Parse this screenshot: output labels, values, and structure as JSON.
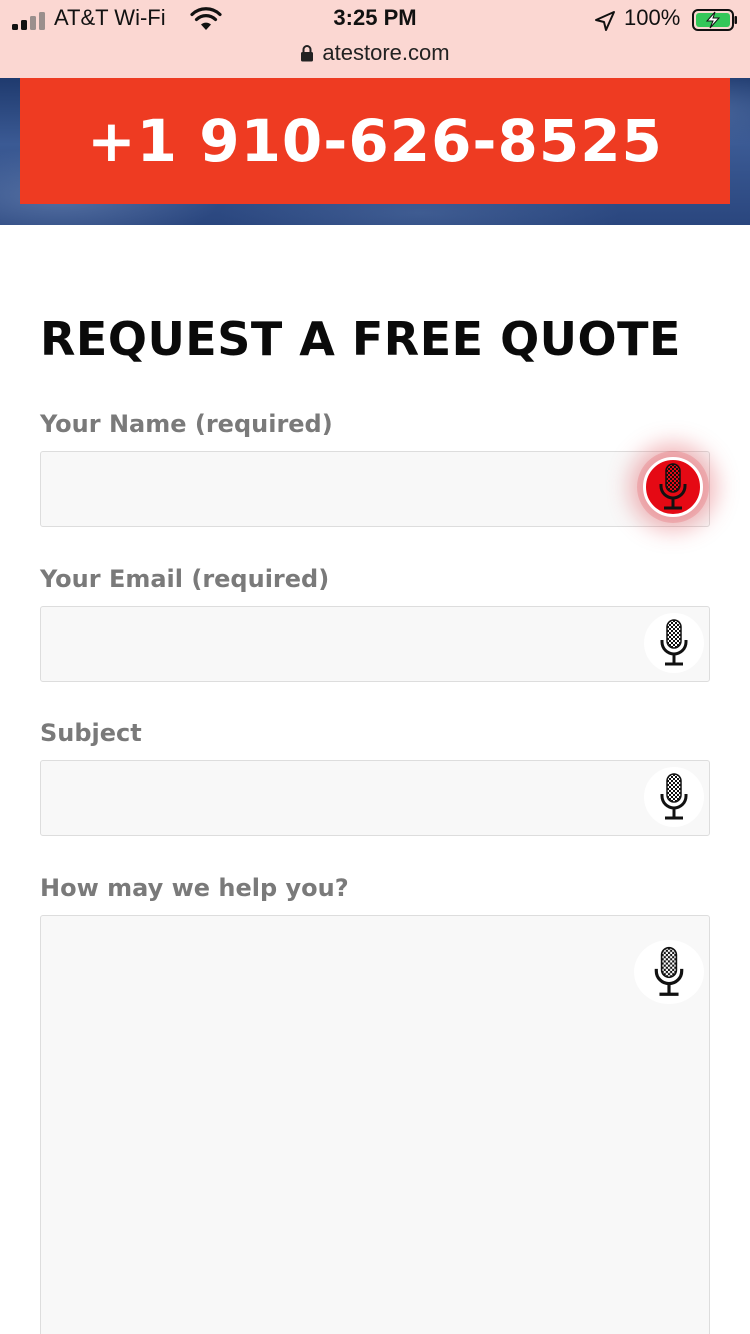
{
  "status_bar": {
    "carrier": "AT&T Wi-Fi",
    "time": "3:25 PM",
    "battery": "100%"
  },
  "browser": {
    "url": "atestore.com"
  },
  "hero": {
    "phone": "+1 910-626-8525",
    "banner_color": "#ee3b22"
  },
  "form": {
    "title": "REQUEST A FREE QUOTE",
    "fields": [
      {
        "label": "Your Name (required)",
        "value": ""
      },
      {
        "label": "Your Email (required)",
        "value": ""
      },
      {
        "label": "Subject",
        "value": ""
      },
      {
        "label": "How may we help you?",
        "value": ""
      }
    ]
  },
  "icons": {
    "signal": "signal-icon",
    "wifi": "wifi-icon",
    "location": "location-arrow-icon",
    "battery": "battery-charging-icon",
    "lock": "lock-icon",
    "microphone": "microphone-icon"
  }
}
